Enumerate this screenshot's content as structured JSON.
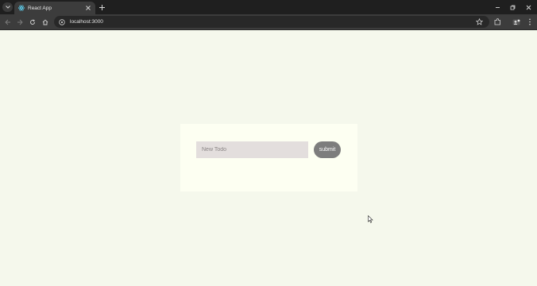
{
  "browser": {
    "tab_title": "React App",
    "url": "localhost:3000"
  },
  "page": {
    "input_placeholder": "New Todo",
    "submit_label": "submit"
  }
}
